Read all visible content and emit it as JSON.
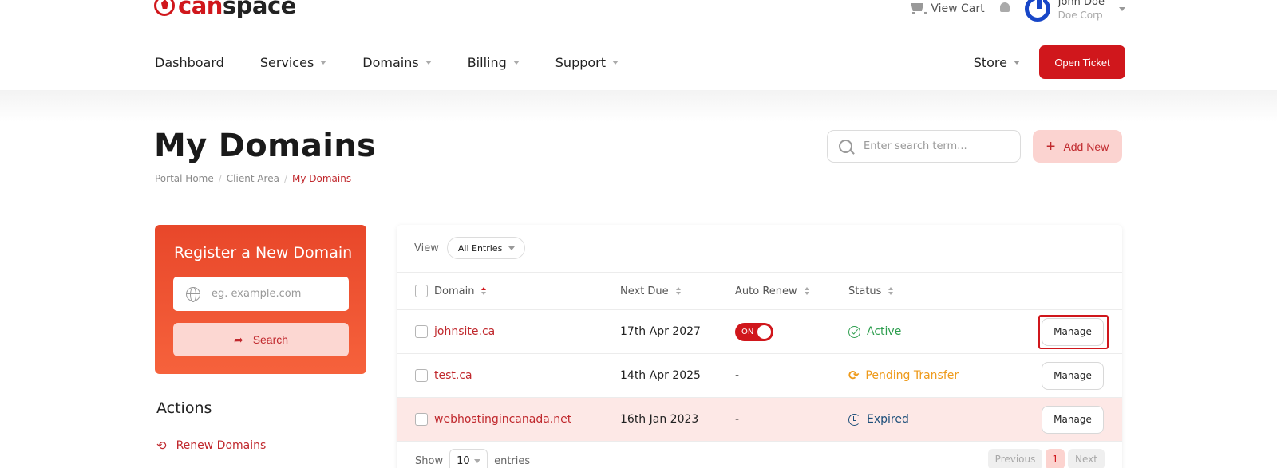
{
  "brand": {
    "logo_prefix": "can",
    "logo_suffix": "space",
    "accent_color": "#d0171c"
  },
  "topbar": {
    "cart_label": "View Cart",
    "user_name": "John Doe",
    "user_org": "Doe Corp"
  },
  "nav": {
    "items": [
      {
        "label": "Dashboard"
      },
      {
        "label": "Services"
      },
      {
        "label": "Domains"
      },
      {
        "label": "Billing"
      },
      {
        "label": "Support"
      }
    ],
    "store_label": "Store",
    "open_ticket_label": "Open Ticket"
  },
  "page": {
    "title": "My Domains",
    "breadcrumb": [
      "Portal Home",
      "Client Area",
      "My Domains"
    ],
    "search_placeholder": "Enter search term...",
    "add_new_label": "Add New"
  },
  "register": {
    "title": "Register a New Domain",
    "placeholder": "eg. example.com",
    "search_label": "Search"
  },
  "actions": {
    "title": "Actions",
    "renew_label": "Renew Domains"
  },
  "table": {
    "view_label": "View",
    "view_value": "All Entries",
    "columns": [
      "Domain",
      "Next Due",
      "Auto Renew",
      "Status"
    ],
    "rows": [
      {
        "domain": "johnsite.ca",
        "next_due": "17th Apr 2027",
        "auto_renew": "ON",
        "status": "Active",
        "action": "Manage"
      },
      {
        "domain": "test.ca",
        "next_due": "14th Apr 2025",
        "auto_renew": "-",
        "status": "Pending Transfer",
        "action": "Manage"
      },
      {
        "domain": "webhostingincanada.net",
        "next_due": "16th Jan 2023",
        "auto_renew": "-",
        "status": "Expired",
        "action": "Manage"
      }
    ],
    "show_label": "Show",
    "entries_value": "10",
    "entries_label": "entries",
    "pager": {
      "previous": "Previous",
      "current": "1",
      "next": "Next"
    }
  }
}
